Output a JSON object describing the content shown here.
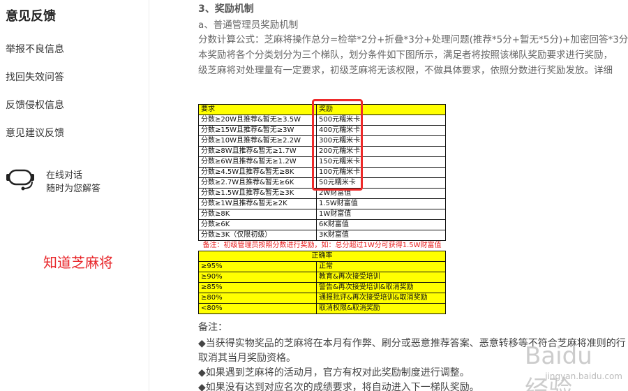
{
  "sidebar": {
    "title": "意见反馈",
    "links": [
      "举报不良信息",
      "找回失效问答",
      "反馈侵权信息",
      "意见建议反馈"
    ],
    "chat": {
      "line1": "在线对话",
      "line2": "随时为您解答",
      "icon": "headset-icon"
    },
    "watermark": "知道芝麻将"
  },
  "article": {
    "section_title": "3、奖励机制",
    "sub_title": "a、普通管理员奖励机制",
    "formula": "分数计算公式：芝麻将操作总分=检举*2分+折叠*3分+处理问题(推荐*5分+暂无*5分)+加密回答*3分",
    "para1": "本奖励将各个分类划分为三个梯队，划分条件如下图所示，满足者将按照该梯队奖励要求进行奖励，",
    "para2": "级芝麻将对处理量有一定要求，初级芝麻将无该权限，不做具体要求，依照分数进行奖励发放。详细",
    "reward_table": {
      "headers": [
        "要求",
        "奖励"
      ],
      "rows": [
        [
          "分数≥20W且推荐&暂无≥3.5W",
          "500元糯米卡"
        ],
        [
          "分数≥15W且推荐&暂无≥3W",
          "400元糯米卡"
        ],
        [
          "分数≥10W且推荐&暂无≥2.2W",
          "300元糯米卡"
        ],
        [
          "分数≥8W且推荐&暂无≥1.7W",
          "200元糯米卡"
        ],
        [
          "分数≥6W且推荐&暂无≥1.2W",
          "150元糯米卡"
        ],
        [
          "分数≥4.5W且推荐&暂无≥8K",
          "100元糯米卡"
        ],
        [
          "分数≥2.7W且推荐&暂无≥6K",
          "50元糯米卡"
        ],
        [
          "分数≥1.5W且推荐&暂无≥3K",
          "2W财富值"
        ],
        [
          "分数≥1W且推荐&暂无≥2K",
          "1.5W财富值"
        ],
        [
          "分数≥8K",
          "1W财富值"
        ],
        [
          "分数≥6K",
          "6K财富值"
        ],
        [
          "分数≥3K（仅限初级）",
          "3K财富值"
        ]
      ],
      "note": "备注：初级管理员按照分数进行奖励，如：总分超过1W分可获得1.5W财富值"
    },
    "accuracy_table": {
      "header": "正确率",
      "rows": [
        [
          "≥95%",
          "正常"
        ],
        [
          "≥90%",
          "教育&再次接受培训"
        ],
        [
          "≥85%",
          "警告&再次接受培训&取消奖励"
        ],
        [
          "≥80%",
          "通报批评&再次接受培训&取消奖励"
        ],
        [
          "<80%",
          "取消权限&取消奖励"
        ]
      ]
    },
    "remarks_title": "备注：",
    "remarks": [
      "◆当获得实物奖品的芝麻将在本月有作弊、刷分或恶意推荐答案、恶意转移等不符合芝麻将准则的行",
      "取消其当月奖励资格。",
      "◆如果遇到芝麻将的活动月，官方有权对此奖励制度进行调整。",
      "◆如果没有达到对应名次的成绩要求，将自动进入下一梯队奖励。"
    ],
    "baidu_watermark": {
      "logo": "Baidu经验",
      "url": "jingyan.baidu.com"
    }
  },
  "colors": {
    "highlight_border": "#ee2a2a",
    "table_header_bg": "#ffff00",
    "note_text": "#e81b1b",
    "watermark": "#e8262a"
  }
}
